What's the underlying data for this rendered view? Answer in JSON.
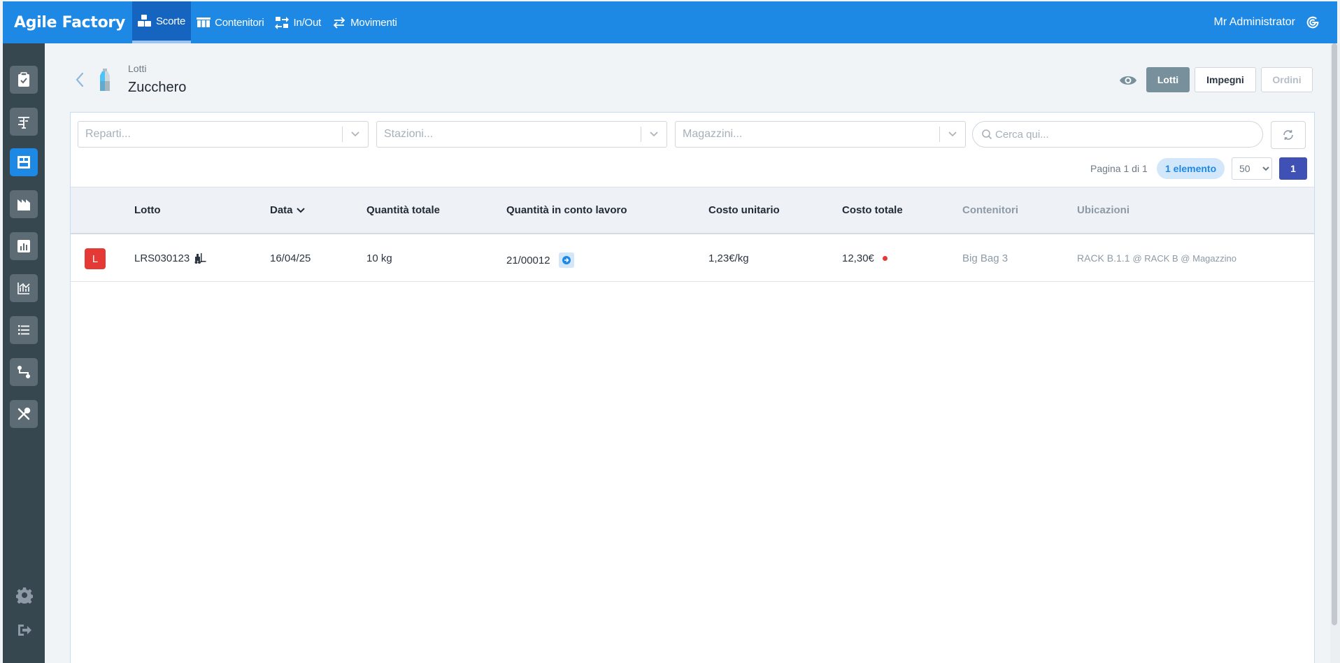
{
  "topbar": {
    "brand": "Agile Factory",
    "nav": [
      {
        "label": "Scorte",
        "icon": "boxes-icon",
        "active": true
      },
      {
        "label": "Contenitori",
        "icon": "containers-icon"
      },
      {
        "label": "In/Out",
        "icon": "in-out-icon"
      },
      {
        "label": "Movimenti",
        "icon": "movements-icon"
      }
    ],
    "user": "Mr Administrator"
  },
  "header": {
    "breadcrumb": "Lotti",
    "title": "Zucchero",
    "tabs": [
      {
        "label": "Lotti",
        "state": "active"
      },
      {
        "label": "Impegni",
        "state": "normal"
      },
      {
        "label": "Ordini",
        "state": "disabled"
      }
    ]
  },
  "filters": {
    "reparti_placeholder": "Reparti...",
    "stazioni_placeholder": "Stazioni...",
    "magazzini_placeholder": "Magazzini...",
    "search_placeholder": "Cerca qui..."
  },
  "pager": {
    "info": "Pagina 1 di 1",
    "count": "1 elemento",
    "per_page": "50",
    "per_page_options": [
      "50"
    ],
    "current_page": "1"
  },
  "table": {
    "columns": {
      "lotto": "Lotto",
      "data": "Data",
      "quantita_totale": "Quantità totale",
      "quantita_conto_lavoro": "Quantità in conto lavoro",
      "costo_unitario": "Costo unitario",
      "costo_totale": "Costo totale",
      "contenitori": "Contenitori",
      "ubicazioni": "Ubicazioni"
    },
    "rows": [
      {
        "badge": "L",
        "lotto": "LRS030123",
        "data": "16/04/25",
        "quantita_totale": "10 kg",
        "quantita_conto_lavoro": "21/00012",
        "costo_unitario": "1,23€/kg",
        "costo_totale": "12,30€",
        "contenitori": "Big Bag 3",
        "ubicazione": "RACK B.1.1",
        "ubicazione_path": "@ RACK B @ Magazzino"
      }
    ]
  },
  "colors": {
    "primary": "#1e88e5",
    "primary_dark": "#1565c0",
    "sidebar": "#37474f",
    "danger": "#e53935",
    "indigo": "#3f51b5"
  }
}
